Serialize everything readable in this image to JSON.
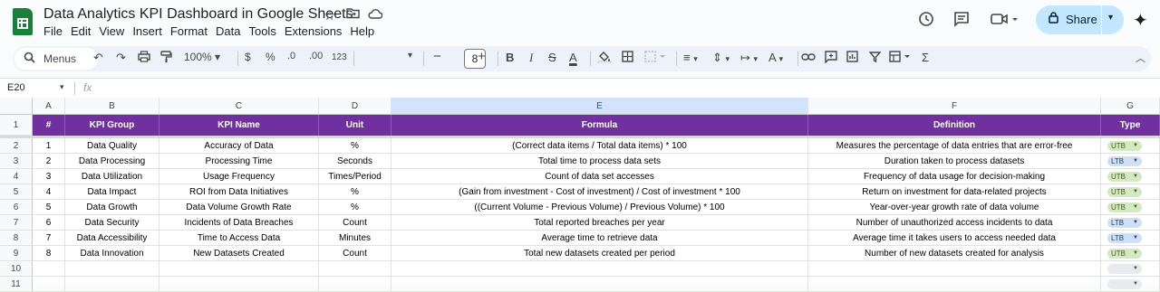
{
  "doc": {
    "title": "Data Analytics KPI Dashboard in Google Sheets",
    "menu": [
      "File",
      "Edit",
      "View",
      "Insert",
      "Format",
      "Data",
      "Tools",
      "Extensions",
      "Help"
    ],
    "share_label": "Share"
  },
  "toolbar": {
    "search_label": "Menus",
    "zoom": "100%",
    "currency": "$",
    "percent": "%",
    "dec_decrease": ".0",
    "dec_increase": ".00",
    "more_formats": "123",
    "font_size": "8"
  },
  "formula_bar": {
    "cell_ref": "E20",
    "fx": "fx",
    "value": ""
  },
  "sheet": {
    "columns": [
      "A",
      "B",
      "C",
      "D",
      "E",
      "F",
      "G"
    ],
    "selected_column": "E",
    "header_row": [
      "#",
      "KPI Group",
      "KPI Name",
      "Unit",
      "Formula",
      "Definition",
      "Type"
    ],
    "row_numbers": [
      "1",
      "2",
      "3",
      "4",
      "5",
      "6",
      "7",
      "8",
      "9",
      "10",
      "11"
    ],
    "rows": [
      {
        "num": "1",
        "group": "Data Quality",
        "name": "Accuracy of Data",
        "unit": "%",
        "formula": "(Correct data items / Total data items) * 100",
        "definition": "Measures the percentage of data entries that are error-free",
        "type": "UTB"
      },
      {
        "num": "2",
        "group": "Data Processing",
        "name": "Processing Time",
        "unit": "Seconds",
        "formula": "Total time to process data sets",
        "definition": "Duration taken to process datasets",
        "type": "LTB"
      },
      {
        "num": "3",
        "group": "Data Utilization",
        "name": "Usage Frequency",
        "unit": "Times/Period",
        "formula": "Count of data set accesses",
        "definition": "Frequency of data usage for decision-making",
        "type": "UTB"
      },
      {
        "num": "4",
        "group": "Data Impact",
        "name": "ROI from Data Initiatives",
        "unit": "%",
        "formula": "(Gain from investment - Cost of investment) / Cost of investment * 100",
        "definition": "Return on investment for data-related projects",
        "type": "UTB"
      },
      {
        "num": "5",
        "group": "Data Growth",
        "name": "Data Volume Growth Rate",
        "unit": "%",
        "formula": "((Current Volume - Previous Volume) / Previous Volume) * 100",
        "definition": "Year-over-year growth rate of data volume",
        "type": "UTB"
      },
      {
        "num": "6",
        "group": "Data Security",
        "name": "Incidents of Data Breaches",
        "unit": "Count",
        "formula": "Total reported breaches per year",
        "definition": "Number of unauthorized access incidents to data",
        "type": "LTB"
      },
      {
        "num": "7",
        "group": "Data Accessibility",
        "name": "Time to Access Data",
        "unit": "Minutes",
        "formula": "Average time to retrieve data",
        "definition": "Average time it takes users to access needed data",
        "type": "LTB"
      },
      {
        "num": "8",
        "group": "Data Innovation",
        "name": "New Datasets Created",
        "unit": "Count",
        "formula": "Total new datasets created per period",
        "definition": "Number of new datasets created for analysis",
        "type": "UTB"
      }
    ]
  },
  "colors": {
    "header_bg": "#7030a0",
    "utb_chip": "#d4e8c1",
    "ltb_chip": "#cfe0f5",
    "share_bg": "#c2e7ff"
  }
}
